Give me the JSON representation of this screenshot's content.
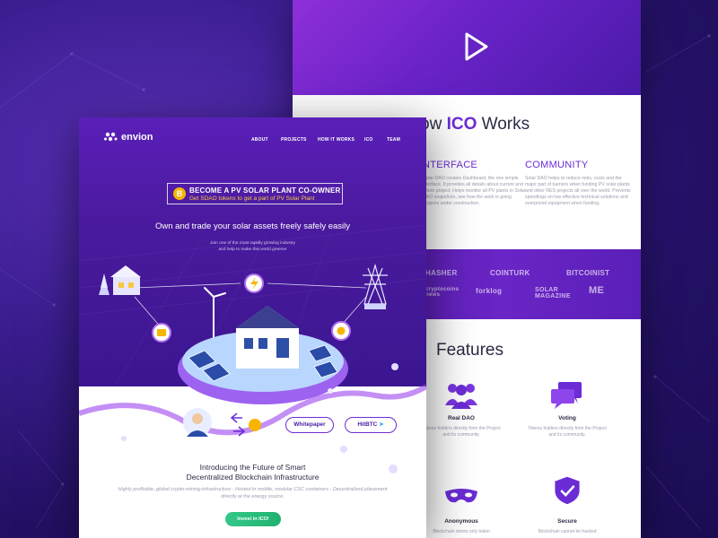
{
  "back_page": {
    "how_title_prefix": "ow ",
    "how_title_accent": "ICO",
    "how_title_suffix": " Works",
    "columns": [
      {
        "heading": "NTERFACE",
        "text": "Solar DAO creates Dashboard, the one simple interface. It provides all details about current and future project. Helps monitor all PV plants in Solar DAO snapshots, see how the work is going projects under construction."
      },
      {
        "heading": "COMMUNITY",
        "text": "Solar DAO helps to reduce risks, costs and the major part of barriers when funding PV solar plants and other RES projects all over the world. Prevents spendings on low effective technical solutions and overpriced equipment when funding."
      }
    ],
    "partners": [
      "HASHER",
      "COINTURK",
      "BITCOINIST",
      "cryptocoins news",
      "forklog",
      "SOLAR MAGAZINE",
      "ME"
    ],
    "features_title": "Features",
    "features": [
      {
        "icon": "people-icon",
        "name": "Real DAO",
        "text": "Tokens holders directly form the Project and its community."
      },
      {
        "icon": "chat-icon",
        "name": "Voting",
        "text": "Tokens holders directly form the Project and its community."
      },
      {
        "icon": "mask-icon",
        "name": "Anonymous",
        "text": "Blockchain stores only token"
      },
      {
        "icon": "shield-check-icon",
        "name": "Secure",
        "text": "Blockchain cannot be hacked"
      }
    ]
  },
  "front_page": {
    "logo": "envion",
    "nav": [
      "ABOUT",
      "PROJECTS",
      "HOW IT WORKS",
      "ICO",
      "TEAM"
    ],
    "banner": {
      "icon": "B",
      "title": "BECOME A PV SOLAR PLANT CO-OWNER",
      "subtitle": "Get SDAO tokens to get a part of PV Solar Plant"
    },
    "tagline": "Own and trade your solar assets freely safely easily",
    "subtag_line1": "Join one of the most rapidly growing industry",
    "subtag_line2": "and help to make this world greener",
    "buttons": {
      "whitepaper": "Whitepaper",
      "hitbtc": "HitBTC"
    },
    "intro_line1": "Introducing the Future of Smart",
    "intro_line2": "Decentralized Blockchain Infrastructure",
    "intro_sub": "Highly profitable, global crypto-mining-infrastructure - Hosted in mobile, modular CSC containers - Decentralized placement directly at the energy source.",
    "invest": "Invest in ICO!"
  },
  "colors": {
    "purple": "#6b2cd6",
    "dark_purple": "#3b1690",
    "green": "#1fb26e",
    "gold": "#f7b500"
  }
}
